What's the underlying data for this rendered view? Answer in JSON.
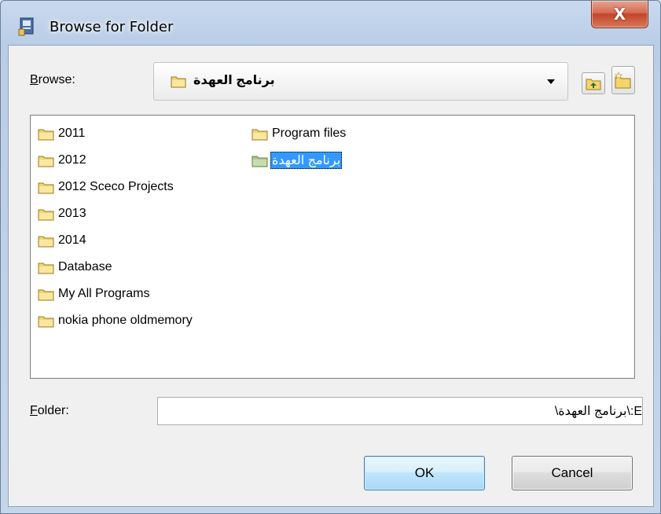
{
  "window": {
    "title": "Browse for Folder",
    "close_glyph": "X"
  },
  "browse": {
    "label_prefix": "",
    "label_accel": "B",
    "label_rest": "rowse:",
    "current_folder": "برنامج العهدة",
    "folder_icon": "folder-icon",
    "up_icon": "up-one-level-icon",
    "new_folder_icon": "new-folder-icon"
  },
  "folders": {
    "column1": [
      {
        "name": "2011"
      },
      {
        "name": "2012"
      },
      {
        "name": "2012 Sceco Projects"
      },
      {
        "name": "2013"
      },
      {
        "name": "2014"
      },
      {
        "name": "Database"
      },
      {
        "name": "My All Programs"
      },
      {
        "name": "nokia phone oldmemory"
      }
    ],
    "column2": [
      {
        "name": "Program files"
      },
      {
        "name": "برنامج العهدة",
        "selected": true
      }
    ]
  },
  "folder_field": {
    "label_accel": "F",
    "label_rest": "older:",
    "value": "E:\\برنامج العهدة\\"
  },
  "buttons": {
    "ok": "OK",
    "cancel": "Cancel"
  },
  "colors": {
    "selection": "#3399ff",
    "folder_yellow": "#f4d56a",
    "close_red": "#c3442a"
  }
}
